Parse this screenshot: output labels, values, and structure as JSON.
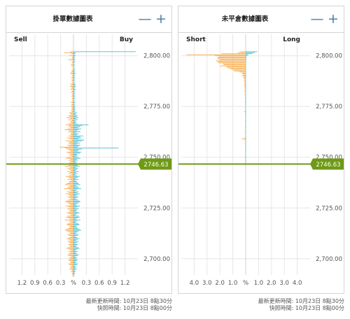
{
  "panels": [
    {
      "title": "掛單數據圖表",
      "minus_label": "—",
      "plus_label": "+",
      "left_label": "Sell",
      "right_label": "Buy",
      "footer_update": "最新更新時間: 10月23日 8點30分",
      "footer_snapshot": "快照時間: 10月23日 8點00分"
    },
    {
      "title": "未平倉數據圖表",
      "minus_label": "—",
      "plus_label": "+",
      "left_label": "Short",
      "right_label": "Long",
      "footer_update": "最新更新時間: 10月23日 8點30分",
      "footer_snapshot": "快照時間: 10月23日 8點00分"
    }
  ],
  "colors": {
    "sell": "#f5a033",
    "buy": "#3bb5c6",
    "current_price": "#6e9a14",
    "grid": "#e6e6e6",
    "axis_text": "#555555",
    "button": "#4a7fa8"
  },
  "chart_data": [
    {
      "type": "bar",
      "orientation": "horizontal",
      "title": "掛單數據圖表",
      "ylim": [
        2692,
        2803
      ],
      "yticks": [
        2800,
        2775,
        2750,
        2725,
        2700
      ],
      "ytick_labels": [
        "2,800.00",
        "2,775.00",
        "2,750.00",
        "2,725.00",
        "2,700.00"
      ],
      "xlim": [
        -1.5,
        1.5
      ],
      "xticks": [
        -1.2,
        -0.9,
        -0.6,
        -0.3,
        0,
        0.3,
        0.6,
        0.9,
        1.2
      ],
      "xtick_labels": [
        "1.2",
        "0.9",
        "0.6",
        "0.3",
        "%",
        "0.3",
        "0.6",
        "0.9",
        "1.2"
      ],
      "current_price": 2746.63,
      "current_price_label": "2746.63",
      "price_step": 0.5,
      "series": [
        {
          "name": "Sell",
          "values": [
            0.08,
            0.22,
            0.06,
            0.02,
            0.1,
            0.03,
            0.03,
            0.05,
            0.12,
            0.02,
            0.04,
            0.03,
            0.02,
            0.06,
            0.05,
            0.02,
            0.01,
            0.02,
            0.03,
            0.05,
            0.04,
            0.08,
            0.05,
            0.02,
            0.04,
            0.03,
            0.06,
            0.02,
            0.05,
            0.03,
            0.02,
            0.04,
            0.07,
            0.05,
            0.09,
            0.05,
            0.05,
            0.07,
            0.02,
            0.04,
            0.06,
            0.02,
            0.04,
            0.03,
            0.05,
            0.02,
            0.04,
            0.03,
            0.02,
            0.04,
            0.06,
            0.02,
            0.05,
            0.04,
            0.07,
            0.03,
            0.05,
            0.04,
            0.06,
            0.04,
            0.1,
            0.08,
            0.06,
            0.12,
            0.09,
            0.16,
            0.07,
            0.12,
            0.05,
            0.08,
            0.06,
            0.11,
            0.18,
            0.1,
            0.12,
            0.07,
            0.14,
            0.2,
            0.09,
            0.13,
            0.05,
            0.08,
            0.06,
            0.12,
            0.07,
            0.15,
            0.09,
            0.04,
            0.18,
            0.1,
            0.12,
            0.07,
            0.14,
            0.1,
            0.32,
            0.2,
            0.15,
            0.1,
            0.08,
            0.16,
            0.12,
            0.06,
            0.1,
            0.05,
            0.14,
            0.18,
            0.08,
            0.12,
            0.06,
            0.1,
            0.09,
            0.16,
            0.12,
            0.2,
            0.08,
            0.14,
            0.1,
            0.06,
            0.15,
            0.08,
            0.12,
            0.05,
            0.1,
            0.18,
            0.12,
            0.08,
            0.14,
            0.06,
            0.1,
            0.12,
            0.16,
            0.2,
            0.08,
            0.12,
            0.14,
            0.22,
            0.1,
            0.06,
            0.15,
            0.1,
            0.18,
            0.12,
            0.08,
            0.14,
            0.1,
            0.06,
            0.12,
            0.16,
            0.2,
            0.14,
            0.1,
            0.08,
            0.18,
            0.12,
            0.06,
            0.14,
            0.1,
            0.08,
            0.12,
            0.16,
            0.1,
            0.06,
            0.14,
            0.18,
            0.12,
            0.08,
            0.2,
            0.1,
            0.06,
            0.12,
            0.16,
            0.14,
            0.08,
            0.1,
            0.12,
            0.18,
            0.2,
            0.15,
            0.1,
            0.08,
            0.14,
            0.12,
            0.06,
            0.1,
            0.16,
            0.12,
            0.08,
            0.14,
            0.1,
            0.06,
            0.12,
            0.1,
            0.08,
            0.14,
            0.16,
            0.1,
            0.06,
            0.12,
            0.08,
            0.1,
            0.14,
            0.12,
            0.06,
            0.1,
            0.08,
            0.12,
            0.1,
            0.06,
            0.08,
            0.12,
            0.1,
            0.04,
            0.08,
            0.06,
            0.1,
            0.05,
            0.04,
            0.06,
            0.03,
            0.04,
            0.02,
            0.03
          ]
        },
        {
          "name": "Buy",
          "values": [
            1.45,
            0.05,
            0.04,
            0.02,
            0.05,
            0.03,
            0.02,
            0.04,
            0.03,
            0.02,
            0.04,
            0.02,
            0.01,
            0.03,
            0.02,
            0.01,
            0.02,
            0.03,
            0.02,
            0.04,
            0.02,
            0.05,
            0.03,
            0.02,
            0.03,
            0.02,
            0.04,
            0.02,
            0.03,
            0.02,
            0.01,
            0.03,
            0.05,
            0.03,
            0.06,
            0.04,
            0.02,
            0.05,
            0.03,
            0.02,
            0.04,
            0.02,
            0.03,
            0.02,
            0.04,
            0.02,
            0.03,
            0.02,
            0.01,
            0.03,
            0.04,
            0.02,
            0.03,
            0.02,
            0.05,
            0.03,
            0.04,
            0.03,
            0.05,
            0.03,
            0.08,
            0.06,
            0.05,
            0.1,
            0.07,
            0.12,
            0.06,
            0.1,
            0.04,
            0.07,
            0.05,
            0.09,
            0.35,
            0.2,
            0.15,
            0.1,
            0.18,
            0.12,
            0.08,
            0.16,
            0.06,
            0.12,
            0.08,
            0.22,
            0.15,
            0.18,
            0.12,
            0.25,
            0.2,
            0.1,
            0.15,
            0.08,
            0.16,
            0.12,
            0.1,
            1.05,
            0.2,
            0.12,
            0.1,
            0.18,
            0.15,
            0.08,
            0.1,
            0.06,
            0.12,
            0.16,
            0.08,
            0.1,
            0.05,
            0.08,
            0.06,
            0.12,
            0.1,
            0.14,
            0.06,
            0.1,
            0.08,
            0.05,
            0.12,
            0.06,
            0.1,
            0.04,
            0.08,
            0.14,
            0.1,
            0.06,
            0.12,
            0.05,
            0.08,
            0.1,
            0.12,
            0.16,
            0.06,
            0.1,
            0.12,
            0.18,
            0.08,
            0.05,
            0.12,
            0.08,
            0.14,
            0.1,
            0.06,
            0.12,
            0.08,
            0.05,
            0.1,
            0.14,
            0.16,
            0.12,
            0.08,
            0.06,
            0.15,
            0.1,
            0.05,
            0.12,
            0.08,
            0.06,
            0.1,
            0.14,
            0.08,
            0.05,
            0.12,
            0.15,
            0.1,
            0.06,
            0.16,
            0.08,
            0.05,
            0.1,
            0.14,
            0.12,
            0.06,
            0.08,
            0.1,
            0.15,
            0.18,
            0.12,
            0.08,
            0.06,
            0.12,
            0.1,
            0.05,
            0.08,
            0.14,
            0.1,
            0.06,
            0.12,
            0.08,
            0.05,
            0.1,
            0.08,
            0.06,
            0.12,
            0.14,
            0.08,
            0.05,
            0.1,
            0.06,
            0.08,
            0.12,
            0.1,
            0.05,
            0.08,
            0.06,
            0.1,
            0.08,
            0.05,
            0.06,
            0.1,
            0.08,
            0.03,
            0.06,
            0.05,
            0.08,
            0.04,
            0.03,
            0.05,
            0.02,
            0.03,
            0.02,
            0.02
          ]
        }
      ]
    },
    {
      "type": "bar",
      "orientation": "horizontal",
      "title": "未平倉數據圖表",
      "ylim": [
        2692,
        2803
      ],
      "yticks": [
        2800,
        2775,
        2750,
        2725,
        2700
      ],
      "ytick_labels": [
        "2,800.00",
        "2,775.00",
        "2,750.00",
        "2,725.00",
        "2,700.00"
      ],
      "xlim": [
        -5,
        5
      ],
      "xticks": [
        -4,
        -3,
        -2,
        -1,
        0,
        1,
        2,
        3,
        4
      ],
      "xtick_labels": [
        "4.0",
        "3.0",
        "2.0",
        "1.0",
        "%",
        "1.0",
        "2.0",
        "3.0",
        "4.0"
      ],
      "current_price": 2746.63,
      "current_price_label": "2746.63",
      "price_step": 0.5,
      "series": [
        {
          "name": "Short",
          "values": [
            0.4,
            0.6,
            1.9,
            4.6,
            2.4,
            2.1,
            2.2,
            2.2,
            2.0,
            2.3,
            2.2,
            2.1,
            1.8,
            1.7,
            2.0,
            1.5,
            1.4,
            1.2,
            1.0,
            0.9,
            0.5,
            0.3,
            0.25,
            0.2,
            0.3,
            0.15,
            0.18,
            0.12,
            0.1,
            0.14,
            0.1,
            0.08,
            0.12,
            0.1,
            0.09,
            0.08,
            0.07,
            0.06,
            0.08,
            0.1,
            0.06,
            0.05,
            0.08,
            0.06,
            0.05,
            0.07,
            0.06,
            0.05,
            0.04,
            0.06,
            0.05,
            0.06,
            0.04,
            0.03,
            0.05,
            0.04,
            0.06,
            0.05,
            0.04,
            0.12,
            0.06,
            0.05,
            0.04,
            0.06,
            0.05,
            0.04,
            0.03,
            0.05,
            0.04,
            0.06,
            0.04,
            0.05,
            0.03,
            0.04,
            0.06,
            0.05,
            0.04,
            0.03,
            0.05,
            0.04,
            0.06,
            0.05,
            0.04,
            0.03,
            0.05,
            0.1,
            0.3,
            0.08,
            0.06,
            0.05,
            0.04,
            0.06,
            0.05,
            0.04,
            0.03,
            0.05,
            0.04,
            0.06,
            0.05,
            0.04,
            0.03,
            0.05,
            0.04,
            0.06,
            0.05,
            0.04,
            0.03,
            0.05,
            0.04,
            0.03,
            0.05,
            0.04,
            0.03
          ]
        },
        {
          "name": "Long",
          "values": [
            0.9,
            0.7,
            0.5,
            0.2,
            0.1,
            0.05,
            0.05,
            0.04,
            0.04,
            0.03,
            0.03,
            0.03,
            0.02,
            0.03,
            0.02,
            0.03,
            0.02,
            0.02,
            0.03,
            0.02,
            0.03,
            0.02,
            0.02,
            0.03,
            0.02,
            0.02,
            0.03,
            0.02,
            0.02,
            0.03,
            0.02,
            0.02,
            0.02,
            0.03,
            0.02,
            0.02,
            0.02,
            0.02,
            0.03,
            0.02,
            0.02,
            0.02,
            0.02,
            0.02,
            0.02,
            0.02,
            0.02,
            0.02,
            0.02,
            0.02,
            0.02,
            0.02,
            0.02,
            0.02,
            0.02,
            0.02,
            0.02,
            0.02,
            0.02,
            0.02,
            0.02,
            0.02,
            0.02,
            0.02,
            0.02,
            0.02,
            0.02,
            0.02,
            0.02,
            0.02,
            0.02,
            0.02,
            0.02,
            0.02,
            0.02,
            0.02,
            0.02,
            0.02,
            0.02,
            0.02,
            0.02,
            0.02,
            0.02,
            0.02,
            0.02,
            0.02,
            0.02,
            0.02,
            0.02,
            0.02,
            0.02,
            0.02,
            0.02,
            0.02,
            0.02,
            0.02,
            0.02,
            0.02,
            0.02,
            0.02,
            0.02,
            0.02,
            0.02,
            0.02,
            0.02,
            0.02,
            0.02,
            0.02,
            0.02,
            0.02,
            0.02,
            0.02,
            0.02
          ]
        }
      ]
    }
  ]
}
